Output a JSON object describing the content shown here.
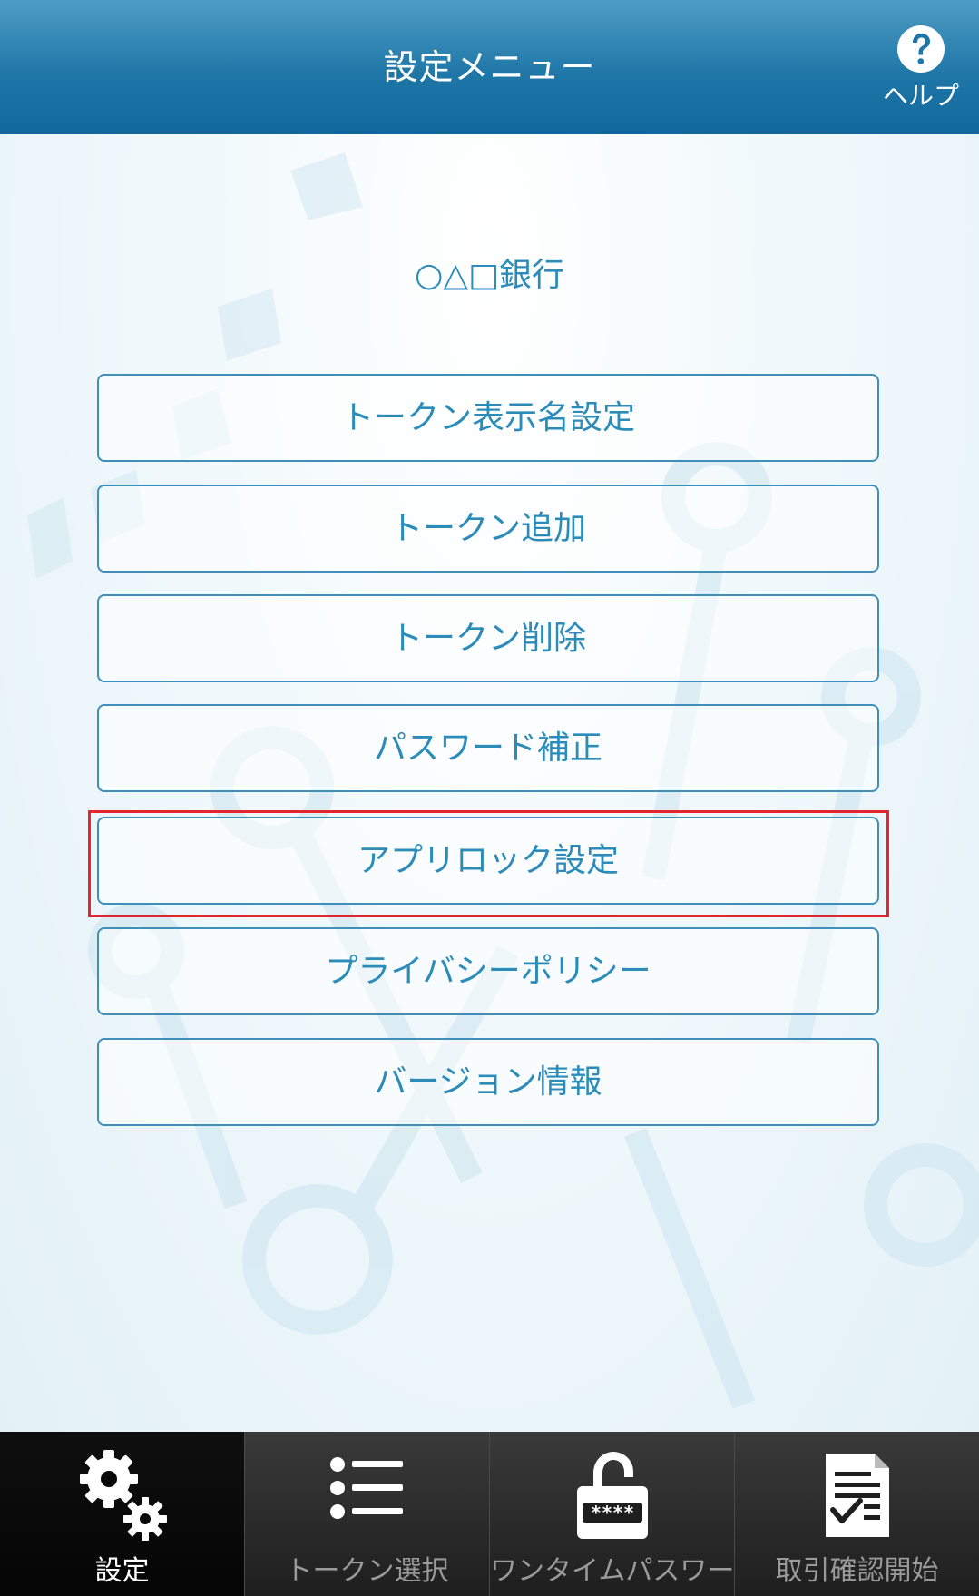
{
  "header": {
    "title": "設定メニュー",
    "help_label": "ヘルプ"
  },
  "bank_name": "○△□銀行",
  "menu": {
    "items": [
      {
        "label": "トークン表示名設定"
      },
      {
        "label": "トークン追加"
      },
      {
        "label": "トークン削除"
      },
      {
        "label": "パスワード補正"
      },
      {
        "label": "アプリロック設定"
      },
      {
        "label": "プライバシーポリシー"
      },
      {
        "label": "バージョン情報"
      }
    ],
    "highlighted_item": "アプリロック設定"
  },
  "tabbar": {
    "tabs": [
      {
        "label": "設定",
        "icon": "gears-icon",
        "active": true
      },
      {
        "label": "トークン選択",
        "icon": "list-icon",
        "active": false
      },
      {
        "label": "ワンタイムパスワード",
        "icon": "padlock-icon",
        "active": false
      },
      {
        "label": "取引確認開始",
        "icon": "checklist-icon",
        "active": false
      }
    ]
  },
  "colors": {
    "header": "#1f77a8",
    "accent": "#2b8cb9",
    "highlight": "#e5252d",
    "tabbar": "#2b2b2b"
  }
}
